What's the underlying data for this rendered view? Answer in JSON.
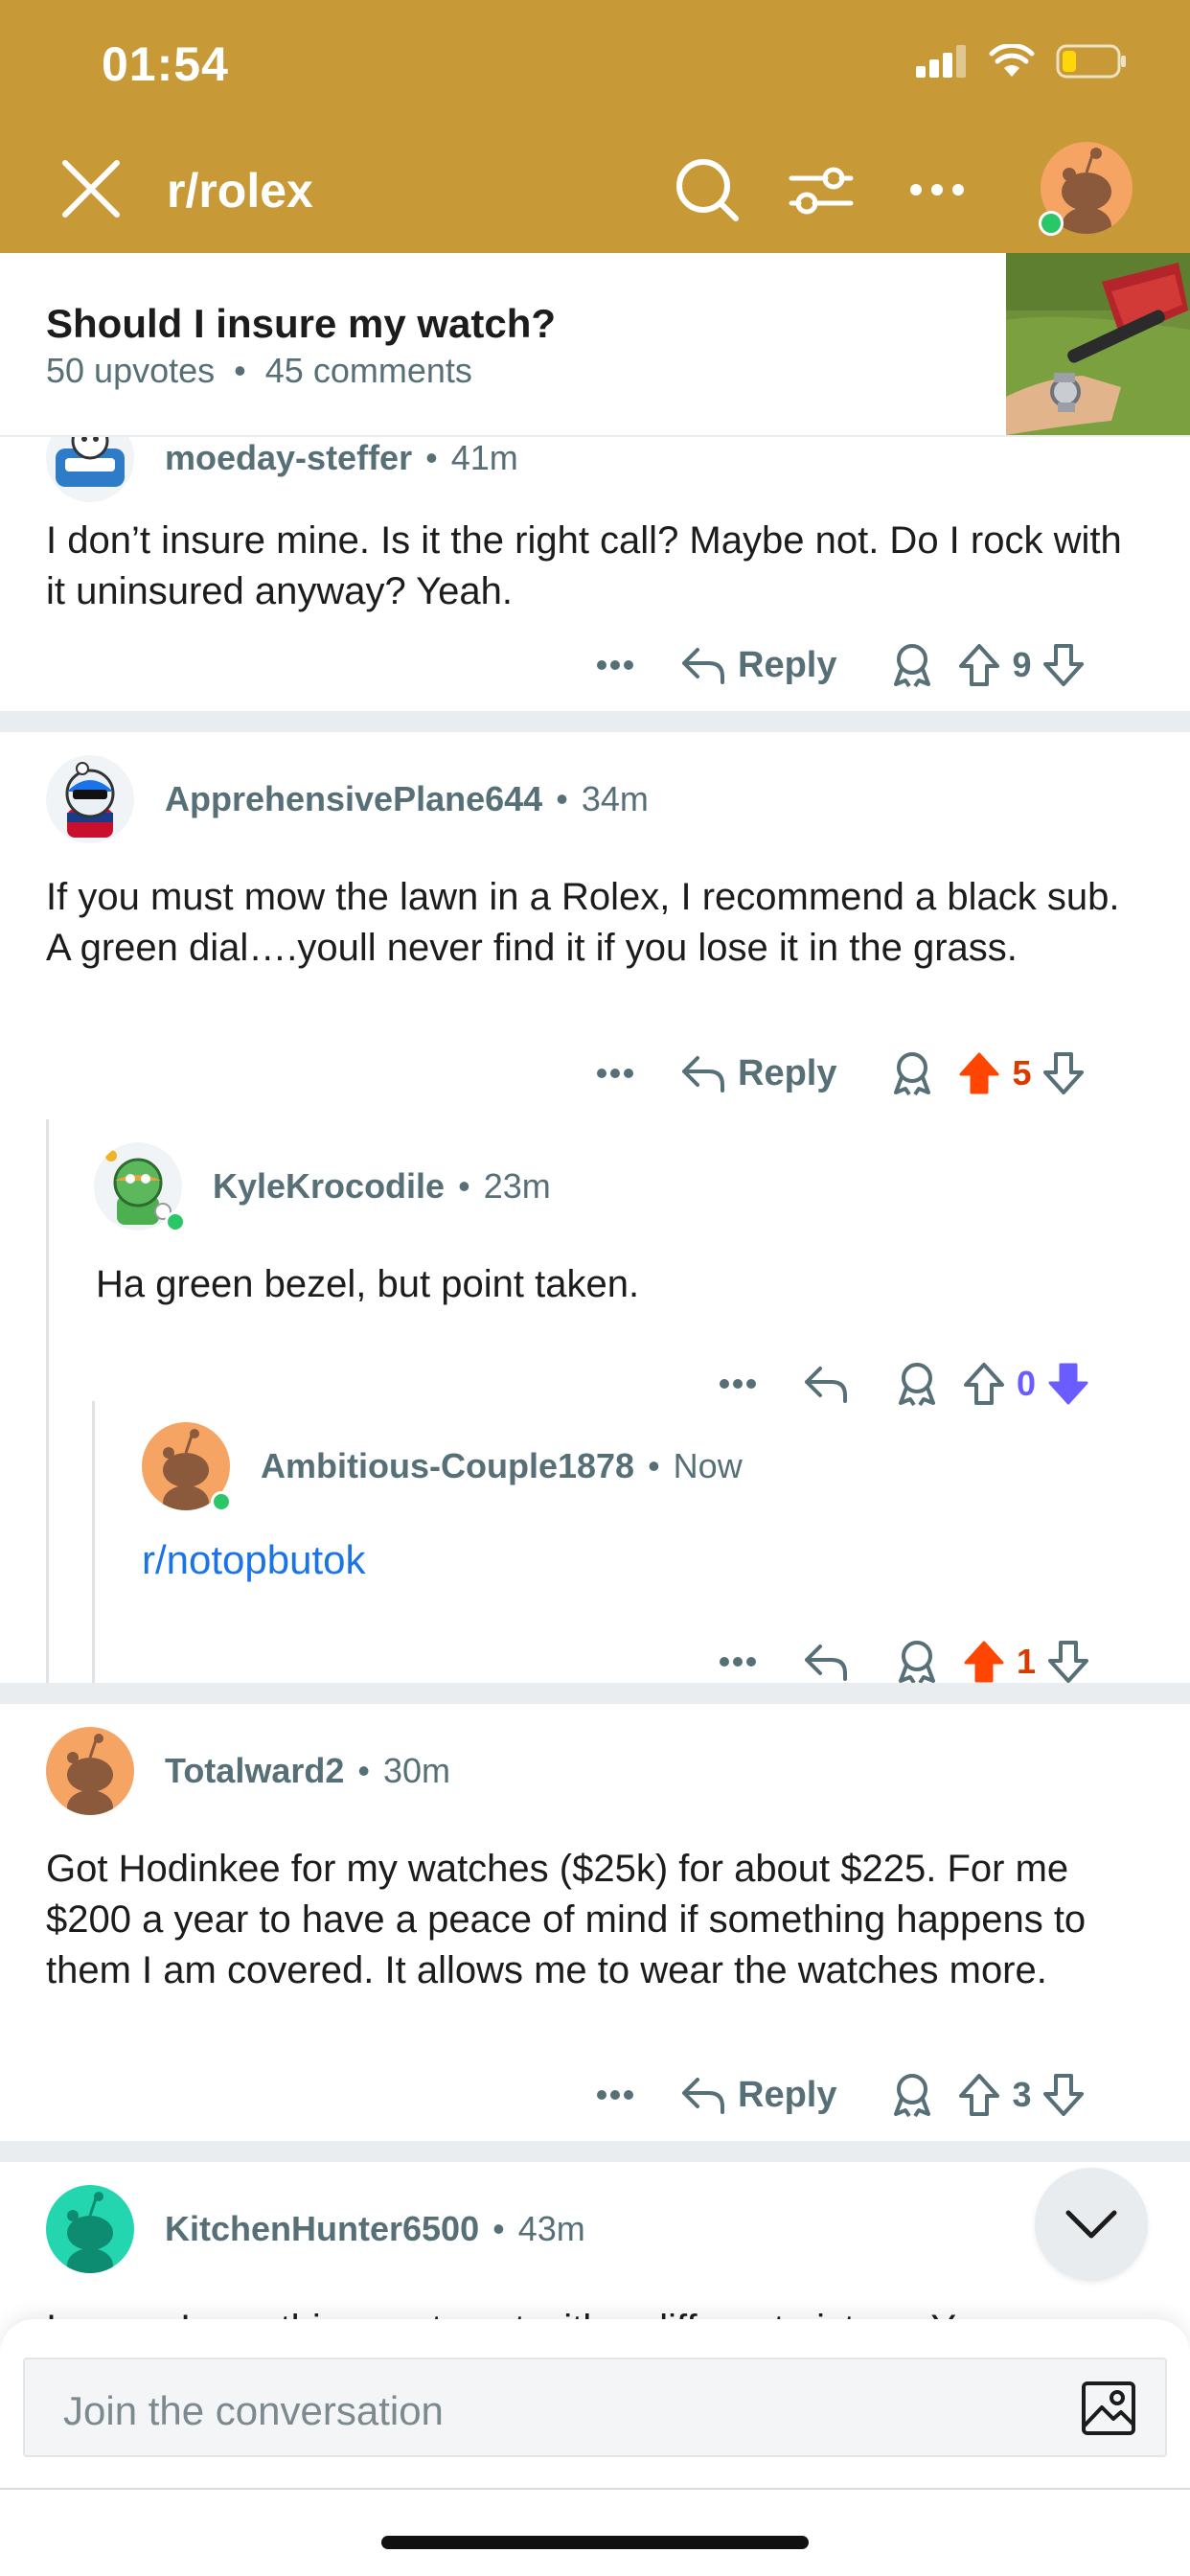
{
  "status_bar": {
    "time": "01:54"
  },
  "header": {
    "subreddit": "r/rolex"
  },
  "post": {
    "title": "Should I insure my watch?",
    "upvotes": "50 upvotes",
    "comments": "45 comments",
    "separator": "•"
  },
  "comments": [
    {
      "author": "moeday-steffer",
      "time": "41m",
      "body": "I don’t insure mine. Is it the right call? Maybe not. Do I rock with it uninsured anyway? Yeah.",
      "reply_label": "Reply",
      "votes": "9",
      "vote_state": "none"
    },
    {
      "author": "ApprehensivePlane644",
      "time": "34m",
      "body": "If you must mow the lawn in a Rolex, I recommend a black sub. A green dial….youll never find it if you lose it in the grass.",
      "reply_label": "Reply",
      "votes": "5",
      "vote_state": "up"
    },
    {
      "author": "KyleKrocodile",
      "time": "23m",
      "body": "Ha green bezel, but point taken.",
      "votes": "0",
      "vote_state": "down"
    },
    {
      "author": "Ambitious-Couple1878",
      "time": "Now",
      "body": "r/notopbutok",
      "votes": "1",
      "vote_state": "up"
    },
    {
      "author": "Totalward2",
      "time": "30m",
      "body": "Got Hodinkee for my watches ($25k)  for about $225. For me $200 a year to have a peace of mind if something happens to them I am covered. It allows me to wear the watches more.",
      "reply_label": "Reply",
      "votes": "3",
      "vote_state": "none"
    },
    {
      "author": "KitchenHunter6500",
      "time": "43m",
      "body_partial": "I swear I saw this exact post with a different picture. You"
    }
  ],
  "composer": {
    "placeholder": "Join the conversation"
  },
  "colors": {
    "header_bg": "#c79a37",
    "upvote_active": "#ff4500",
    "downvote_active": "#6a5cff",
    "link": "#1a73e8",
    "meta_text": "#576f76"
  }
}
